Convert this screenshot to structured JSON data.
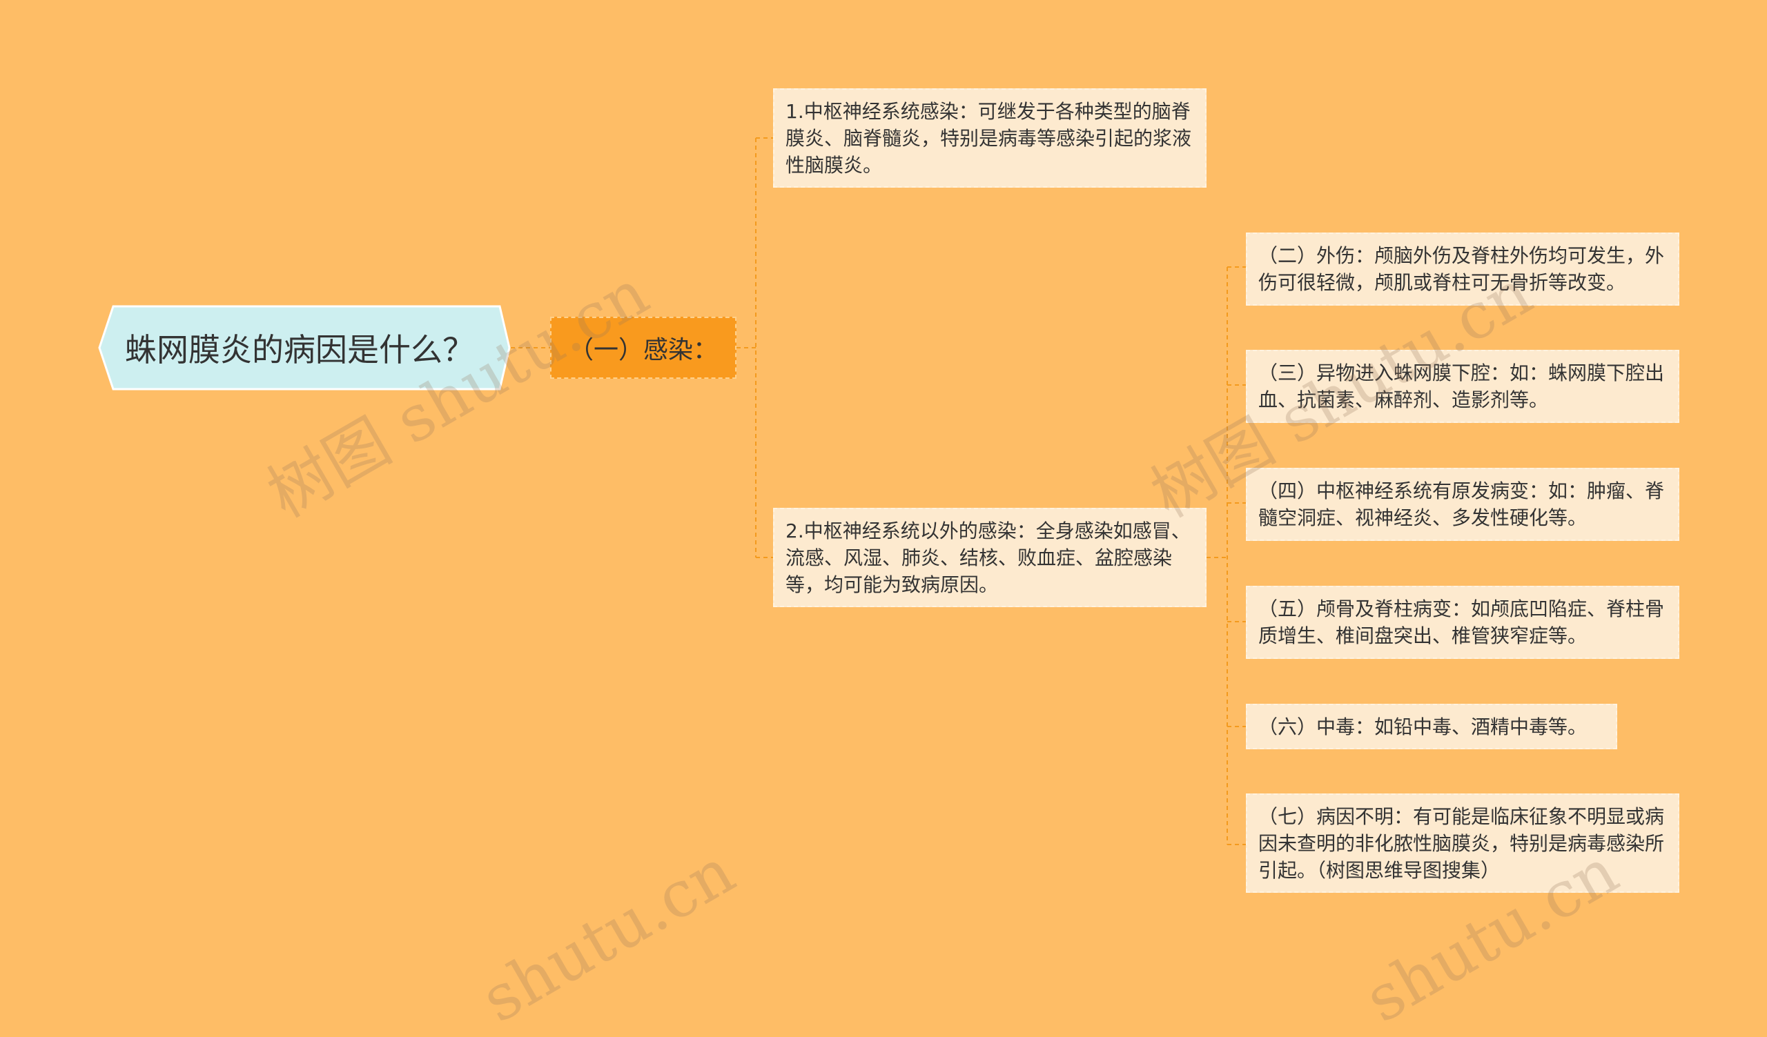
{
  "root": {
    "label": "蛛网膜炎的病因是什么？"
  },
  "branch": {
    "label": "（一）感染："
  },
  "infection_items": [
    "1.中枢神经系统感染：可继发于各种类型的脑脊膜炎、脑脊髓炎，特别是病毒等感染引起的浆液性脑膜炎。",
    "2.中枢神经系统以外的感染：全身感染如感冒、流感、风湿、肺炎、结核、败血症、盆腔感染等，均可能为致病原因。"
  ],
  "other_causes": [
    "（二）外伤：颅脑外伤及脊柱外伤均可发生，外伤可很轻微，颅肌或脊柱可无骨折等改变。",
    "（三）异物进入蛛网膜下腔：如：蛛网膜下腔出血、抗菌素、麻醉剂、造影剂等。",
    "（四）中枢神经系统有原发病变：如：肿瘤、脊髓空洞症、视神经炎、多发性硬化等。",
    "（五）颅骨及脊柱病变：如颅底凹陷症、脊柱骨质增生、椎间盘突出、椎管狭窄症等。",
    "（六）中毒：如铅中毒、酒精中毒等。",
    "（七）病因不明：有可能是临床征象不明显或病因未查明的非化脓性脑膜炎，特别是病毒感染所引起。（树图思维导图搜集）"
  ],
  "watermarks": [
    "树图 shutu.cn",
    "树图 shutu.cn",
    "shutu.cn",
    "shutu.cn"
  ],
  "colors": {
    "background": "#FEBD66",
    "root_fill": "#CDEFF0",
    "root_border": "#FFFFFF",
    "branch_fill": "#F99A1E",
    "leaf_fill": "#FDEACF",
    "connector": "#F39A1E"
  }
}
